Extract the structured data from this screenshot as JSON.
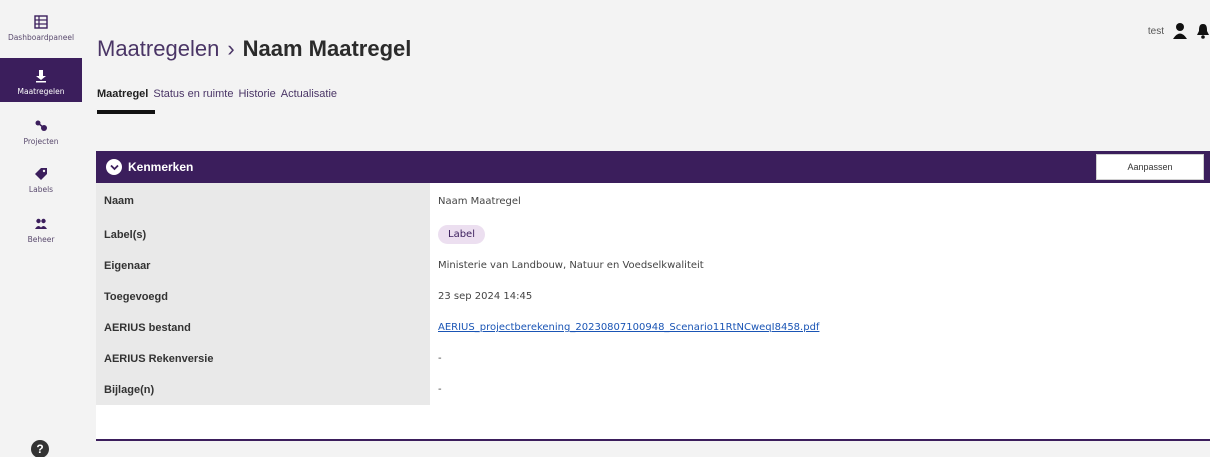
{
  "sidebar": {
    "items": [
      {
        "label": "Dashboardpaneel",
        "icon": "dashboard-icon"
      },
      {
        "label": "Maatregelen",
        "icon": "measures-icon"
      },
      {
        "label": "Projecten",
        "icon": "projects-icon"
      },
      {
        "label": "Labels",
        "icon": "tag-icon"
      },
      {
        "label": "Beheer",
        "icon": "users-icon"
      }
    ],
    "active": "Maatregelen",
    "help_label": "?"
  },
  "header": {
    "breadcrumb_parent": "Maatregelen",
    "separator": "›",
    "title": "Naam Maatregel",
    "username": "test"
  },
  "tabs": [
    {
      "label": "Maatregel",
      "active": true
    },
    {
      "label": "Status en ruimte",
      "active": false
    },
    {
      "label": "Historie",
      "active": false
    },
    {
      "label": "Actualisatie",
      "active": false
    }
  ],
  "panel": {
    "title": "Kenmerken",
    "edit_label": "Aanpassen",
    "rows": [
      {
        "key": "Naam",
        "value": "Naam Maatregel"
      },
      {
        "key": "Label(s)",
        "value": "Label"
      },
      {
        "key": "Eigenaar",
        "value": "Ministerie van Landbouw, Natuur en Voedselkwaliteit"
      },
      {
        "key": "Toegevoegd",
        "value": "23 sep 2024 14:45"
      },
      {
        "key": "AERIUS bestand",
        "value": "AERIUS_projectberekening_20230807100948_Scenario11RtNCweqI8458.pdf"
      },
      {
        "key": "AERIUS Rekenversie",
        "value": "-"
      },
      {
        "key": "Bijlage(n)",
        "value": "-"
      }
    ]
  },
  "colors": {
    "primary": "#3b1e5c",
    "badge_bg": "#ecdff0",
    "link": "#1a55b5"
  }
}
